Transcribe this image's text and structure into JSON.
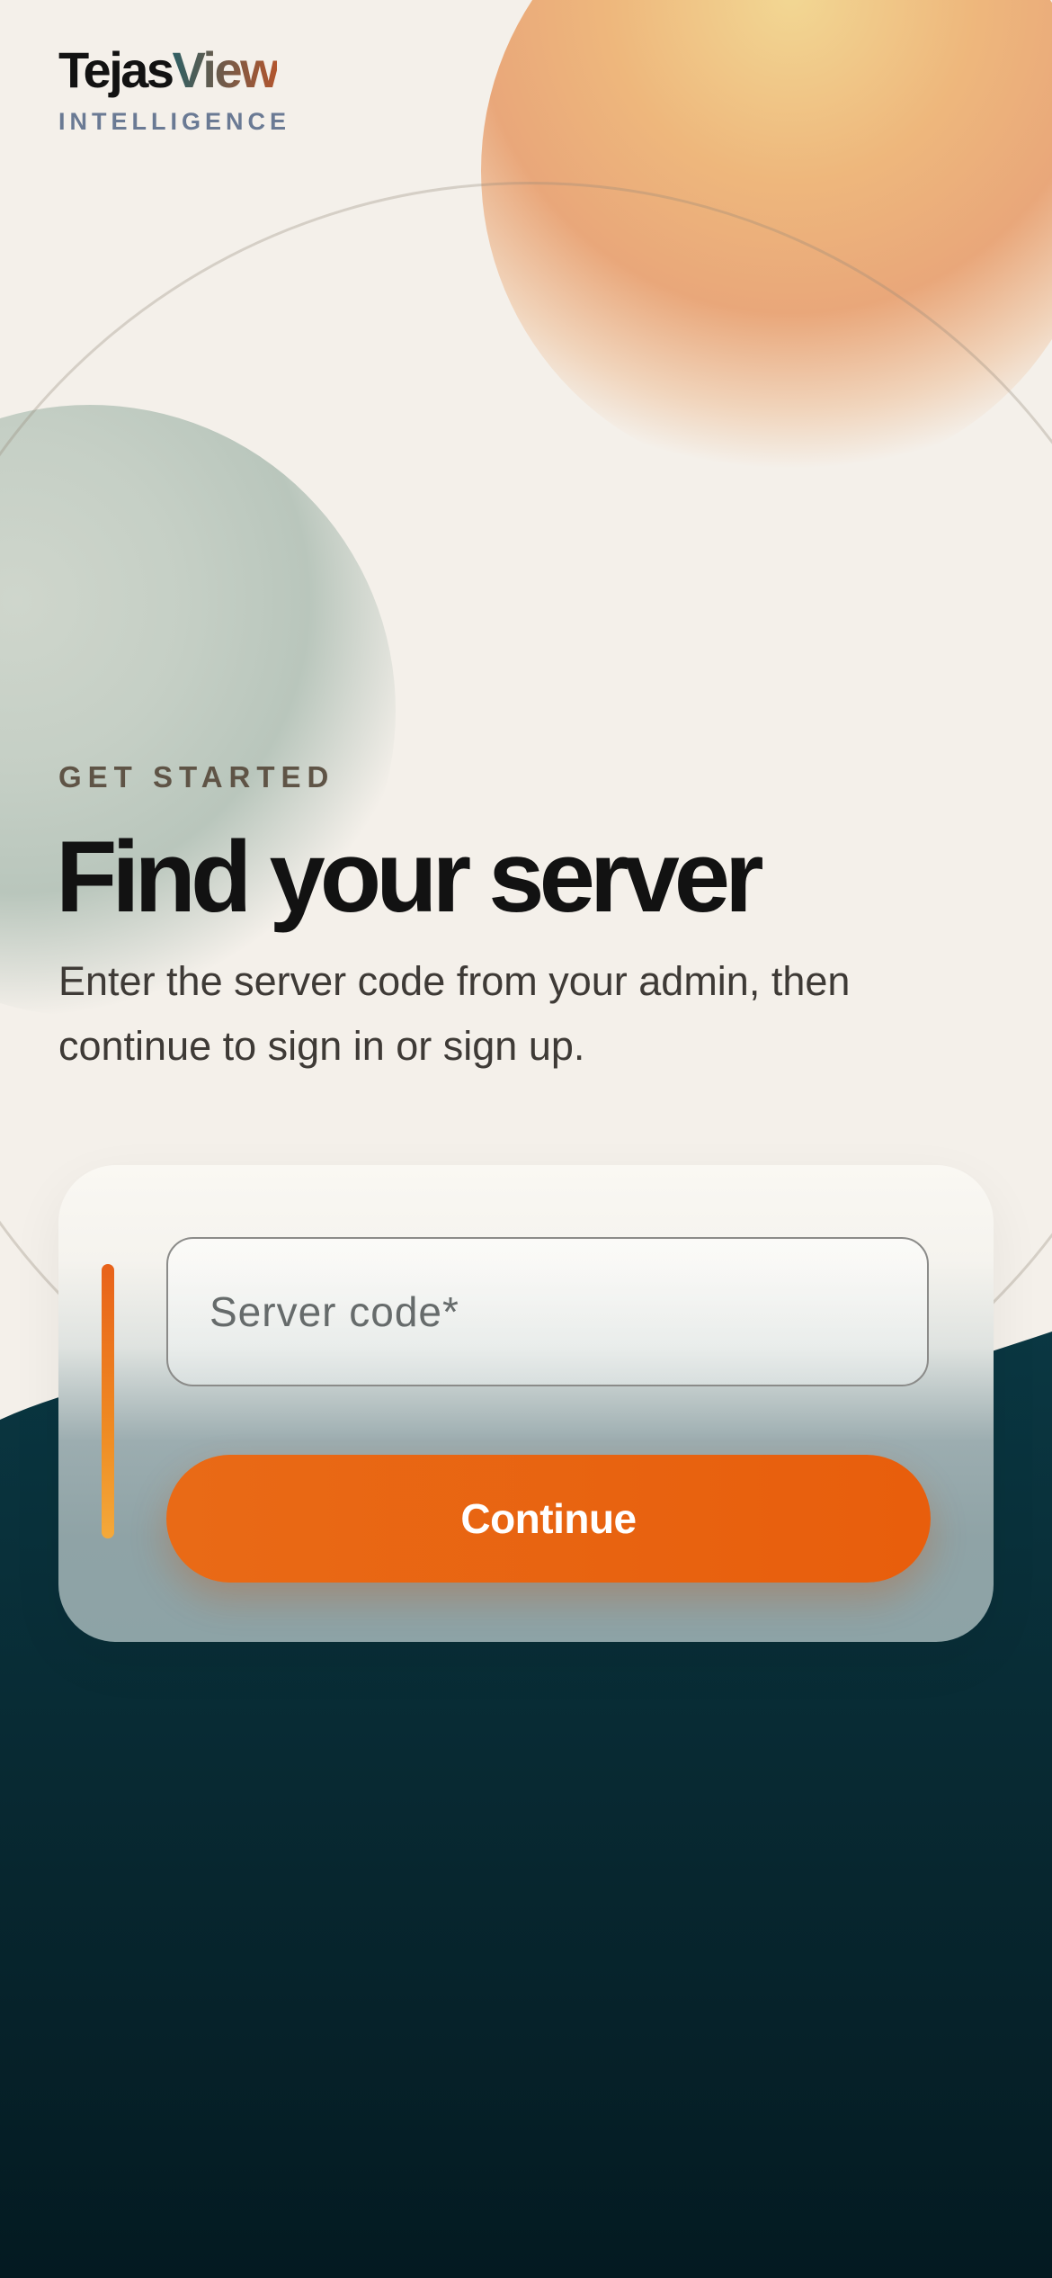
{
  "brand": {
    "name_part1": "Tejas",
    "name_part2": "View",
    "tagline": "INTELLIGENCE"
  },
  "hero": {
    "eyebrow": "GET STARTED",
    "title": "Find your server",
    "subtitle": "Enter the server code from your admin, then continue to sign in or sign up."
  },
  "form": {
    "server_code_placeholder": "Server code*",
    "server_code_value": "",
    "continue_label": "Continue"
  },
  "colors": {
    "accent": "#e8620f",
    "background": "#f4f0ea",
    "dark_teal": "#0a3540"
  }
}
